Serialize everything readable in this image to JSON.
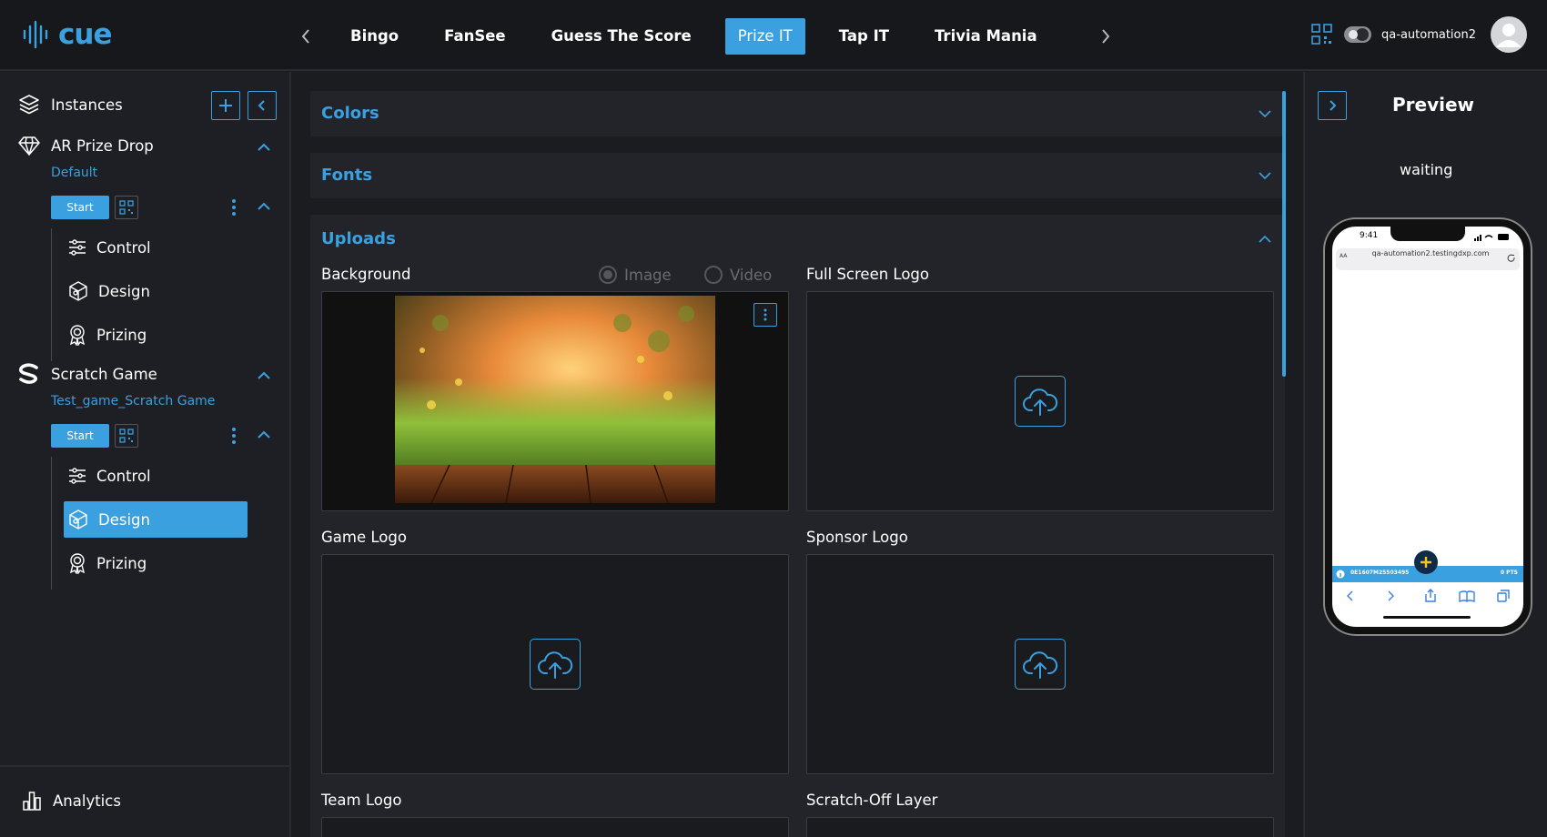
{
  "app": {
    "logo_text": "cue",
    "accent": "#3aa0e0"
  },
  "header": {
    "tabs": [
      {
        "label": "Bingo"
      },
      {
        "label": "FanSee"
      },
      {
        "label": "Guess The Score"
      },
      {
        "label": "Prize IT",
        "active": true
      },
      {
        "label": "Tap IT"
      },
      {
        "label": "Trivia Mania"
      }
    ],
    "username": "qa-automation2"
  },
  "sidebar": {
    "instances_label": "Instances",
    "games": [
      {
        "name": "AR Prize Drop",
        "instance": "Default",
        "start_label": "Start",
        "items": [
          {
            "label": "Control"
          },
          {
            "label": "Design"
          },
          {
            "label": "Prizing"
          }
        ]
      },
      {
        "name": "Scratch Game",
        "instance": "Test_game_Scratch Game",
        "start_label": "Start",
        "items": [
          {
            "label": "Control"
          },
          {
            "label": "Design",
            "active": true
          },
          {
            "label": "Prizing"
          }
        ]
      }
    ],
    "analytics_label": "Analytics"
  },
  "main": {
    "sections": {
      "colors": "Colors",
      "fonts": "Fonts",
      "uploads": "Uploads"
    },
    "uploads": {
      "background": "Background",
      "image_option": "Image",
      "video_option": "Video",
      "full_screen_logo": "Full Screen Logo",
      "game_logo": "Game Logo",
      "sponsor_logo": "Sponsor Logo",
      "team_logo": "Team Logo",
      "scratch_off_layer": "Scratch-Off Layer"
    }
  },
  "preview": {
    "title": "Preview",
    "status": "waiting",
    "phone": {
      "time": "9:41",
      "text_size": "AA",
      "url": "qa-automation2.testingdxp.com",
      "footer_id": "0E1607M25503495",
      "footer_pts": "0 PTS"
    }
  }
}
